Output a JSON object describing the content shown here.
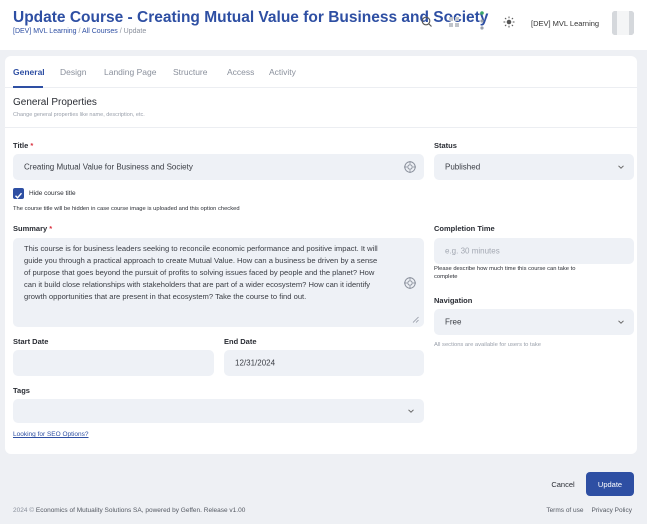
{
  "header": {
    "title": "Update Course - Creating Mutual Value for Business and Society",
    "breadcrumb": [
      "[DEV] MVL Learning",
      "All Courses",
      "Update"
    ],
    "breadcrumb_sep": " / ",
    "org_name": "[DEV] MVL Learning",
    "icons": [
      "search-icon",
      "apps-grid-icon",
      "network-icon",
      "theme-sun-icon"
    ]
  },
  "tabs": [
    "General",
    "Design",
    "Landing Page",
    "Structure",
    "Access",
    "Activity"
  ],
  "active_tab": "General",
  "section": {
    "title": "General Properties",
    "subtitle": "Change general properties like name, description, etc."
  },
  "form": {
    "title_label": "Title",
    "title_value": "Creating Mutual Value for Business and Society",
    "required_mark": "*",
    "hide_title_label": "Hide course title",
    "hide_title_checked": true,
    "hide_title_note": "The course title will be hidden in case course image is uploaded and this option checked",
    "summary_label": "Summary",
    "summary_value": "This course is for business leaders seeking to reconcile economic performance and positive impact. It will guide you through a practical approach to create Mutual Value. How can a business be driven by a sense of purpose that goes beyond the pursuit of profits to solving issues faced by people and the planet? How can it build close relationships with stakeholders that are part of a wider ecosystem? How can it identify growth opportunities that are present in that ecosystem? Take the course to find out.",
    "start_date_label": "Start Date",
    "start_date_value": "",
    "end_date_label": "End Date",
    "end_date_value": "12/31/2024",
    "tags_label": "Tags",
    "seo_link": "Looking for SEO Options?",
    "status_label": "Status",
    "status_value": "Published",
    "completion_label": "Completion Time",
    "completion_placeholder": "e.g. 30 minutes",
    "completion_help_1": "Please describe how much time this course can take to",
    "completion_help_2": "complete",
    "navigation_label": "Navigation",
    "navigation_value": "Free",
    "navigation_help": "All sections are available for users to take"
  },
  "actions": {
    "cancel": "Cancel",
    "update": "Update"
  },
  "footer": {
    "year": "2024 ©",
    "company": "Economics of Mutuality Solutions SA,",
    "powered": "powered by Geffen. Release v1.00",
    "links": [
      "Terms of use",
      "Privacy Policy"
    ]
  },
  "colors": {
    "accent": "#2e4fa3",
    "required": "#d9303e",
    "field_bg": "#eef1f6"
  }
}
